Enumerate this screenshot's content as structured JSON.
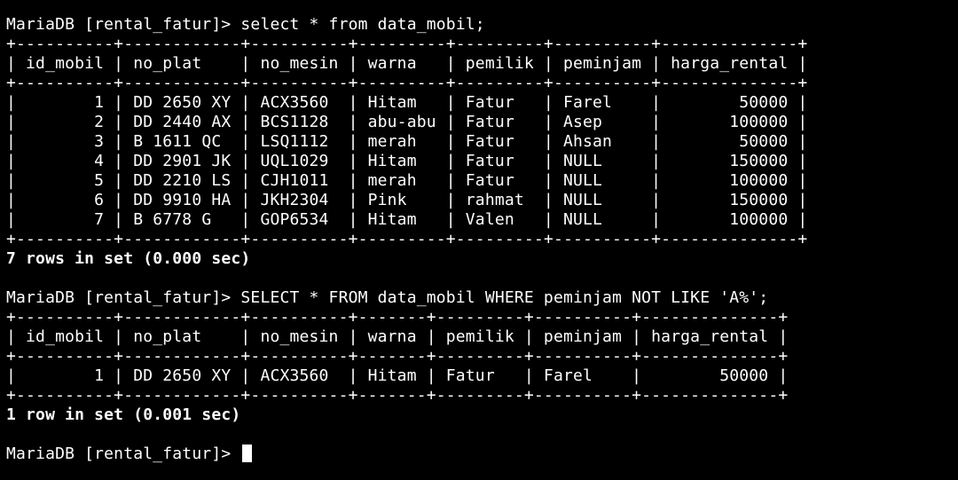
{
  "colors": {
    "background": "#000000",
    "foreground": "#ffffff"
  },
  "session": {
    "prompt": "MariaDB [rental_fatur]> "
  },
  "query1": {
    "command": "select * from data_mobil;",
    "lines": [
      "+----------+------------+----------+---------+---------+----------+--------------+",
      "| id_mobil | no_plat    | no_mesin | warna   | pemilik | peminjam | harga_rental |",
      "+----------+------------+----------+---------+---------+----------+--------------+",
      "|        1 | DD 2650 XY | ACX3560  | Hitam   | Fatur   | Farel    |        50000 |",
      "|        2 | DD 2440 AX | BCS1128  | abu-abu | Fatur   | Asep     |       100000 |",
      "|        3 | B 1611 QC  | LSQ1112  | merah   | Fatur   | Ahsan    |        50000 |",
      "|        4 | DD 2901 JK | UQL1029  | Hitam   | Fatur   | NULL     |       150000 |",
      "|        5 | DD 2210 LS | CJH1011  | merah   | Fatur   | NULL     |       100000 |",
      "|        6 | DD 9910 HA | JKH2304  | Pink    | rahmat  | NULL     |       150000 |",
      "|        7 | B 6778 G   | GOP6534  | Hitam   | Valen   | NULL     |       100000 |",
      "+----------+------------+----------+---------+---------+----------+--------------+"
    ],
    "status": "7 rows in set (0.000 sec)"
  },
  "query2": {
    "command": "SELECT * FROM data_mobil WHERE peminjam NOT LIKE 'A%';",
    "lines": [
      "+----------+------------+----------+-------+---------+----------+--------------+",
      "| id_mobil | no_plat    | no_mesin | warna | pemilik | peminjam | harga_rental |",
      "+----------+------------+----------+-------+---------+----------+--------------+",
      "|        1 | DD 2650 XY | ACX3560  | Hitam | Fatur   | Farel    |        50000 |",
      "+----------+------------+----------+-------+---------+----------+--------------+"
    ],
    "status": "1 row in set (0.001 sec)"
  }
}
